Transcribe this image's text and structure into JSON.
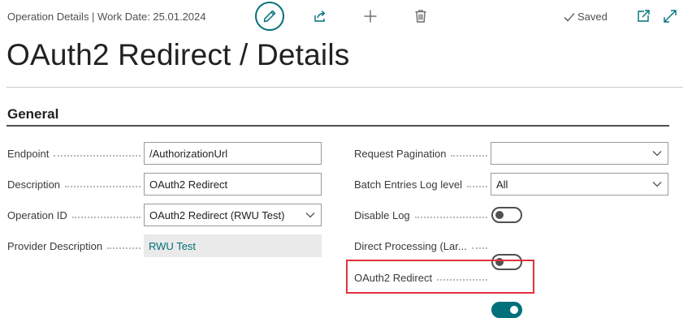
{
  "header": {
    "caption": "Operation Details | Work Date: 25.01.2024",
    "saved_label": "Saved"
  },
  "toolbar": {
    "icons": [
      "edit-icon",
      "share-icon",
      "new-icon",
      "delete-icon",
      "open-new-window-icon",
      "expand-icon"
    ]
  },
  "page": {
    "title": "OAuth2 Redirect / Details"
  },
  "section": {
    "title": "General"
  },
  "left_fields": [
    {
      "label": "Endpoint",
      "value": "/AuthorizationUrl",
      "kind": "text"
    },
    {
      "label": "Description",
      "value": "OAuth2 Redirect",
      "kind": "text"
    },
    {
      "label": "Operation ID",
      "value": "OAuth2 Redirect (RWU Test)",
      "kind": "select"
    },
    {
      "label": "Provider Description",
      "value": "RWU Test",
      "kind": "readonly"
    }
  ],
  "right_fields": [
    {
      "label": "Request Pagination",
      "value": "",
      "kind": "select"
    },
    {
      "label": "Batch Entries Log level",
      "value": "All",
      "kind": "select"
    },
    {
      "label": "Disable Log",
      "state": "off",
      "kind": "toggle"
    },
    {
      "label": "Direct Processing (Lar...",
      "state": "off",
      "kind": "toggle"
    },
    {
      "label": "OAuth2 Redirect",
      "state": "on",
      "kind": "toggle"
    }
  ],
  "colors": {
    "accent": "#00707a",
    "highlight": "#e2323c",
    "readonly_bg": "#eaeaea"
  }
}
